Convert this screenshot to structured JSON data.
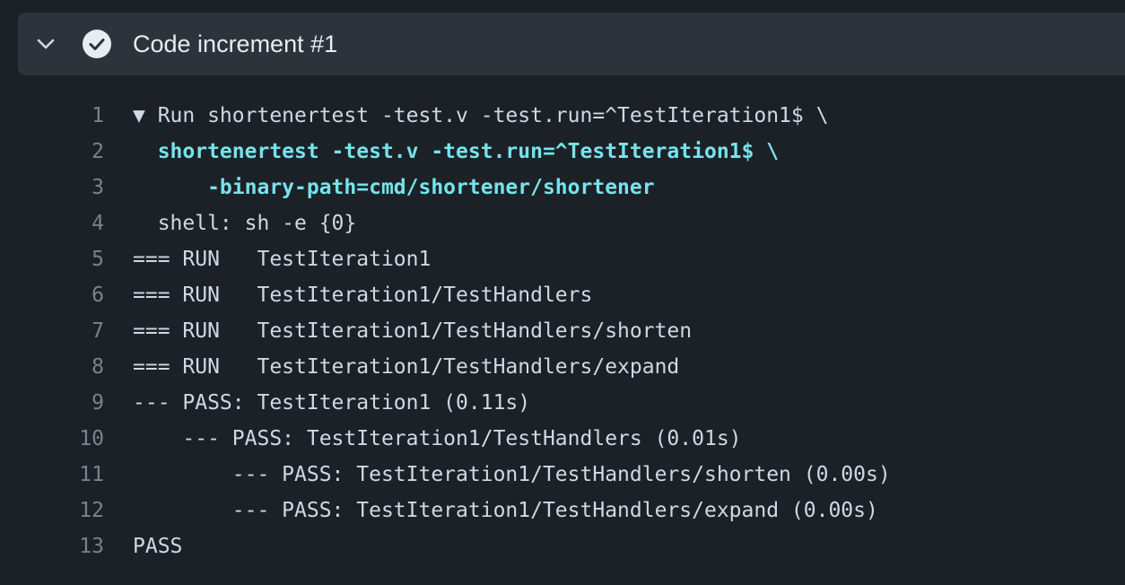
{
  "step": {
    "title": "Code increment #1",
    "status": "success",
    "expanded": true
  },
  "colors": {
    "background": "#1c2128",
    "header_background": "#2d333b",
    "text": "#cdd9e5",
    "line_number": "#768390",
    "command_highlight": "#76e3ea"
  },
  "icons": {
    "expand_toggle": "chevron-down-icon",
    "status": "check-circle-icon"
  },
  "log": {
    "lines": [
      {
        "number": "1",
        "text": "▼ Run shortenertest -test.v -test.run=^TestIteration1$ \\",
        "style": "plain"
      },
      {
        "number": "2",
        "text": "  shortenertest -test.v -test.run=^TestIteration1$ \\",
        "style": "cmd"
      },
      {
        "number": "3",
        "text": "      -binary-path=cmd/shortener/shortener",
        "style": "cmd"
      },
      {
        "number": "4",
        "text": "  shell: sh -e {0}",
        "style": "plain"
      },
      {
        "number": "5",
        "text": "=== RUN   TestIteration1",
        "style": "plain"
      },
      {
        "number": "6",
        "text": "=== RUN   TestIteration1/TestHandlers",
        "style": "plain"
      },
      {
        "number": "7",
        "text": "=== RUN   TestIteration1/TestHandlers/shorten",
        "style": "plain"
      },
      {
        "number": "8",
        "text": "=== RUN   TestIteration1/TestHandlers/expand",
        "style": "plain"
      },
      {
        "number": "9",
        "text": "--- PASS: TestIteration1 (0.11s)",
        "style": "plain"
      },
      {
        "number": "10",
        "text": "    --- PASS: TestIteration1/TestHandlers (0.01s)",
        "style": "plain"
      },
      {
        "number": "11",
        "text": "        --- PASS: TestIteration1/TestHandlers/shorten (0.00s)",
        "style": "plain"
      },
      {
        "number": "12",
        "text": "        --- PASS: TestIteration1/TestHandlers/expand (0.00s)",
        "style": "plain"
      },
      {
        "number": "13",
        "text": "PASS",
        "style": "plain"
      }
    ]
  }
}
